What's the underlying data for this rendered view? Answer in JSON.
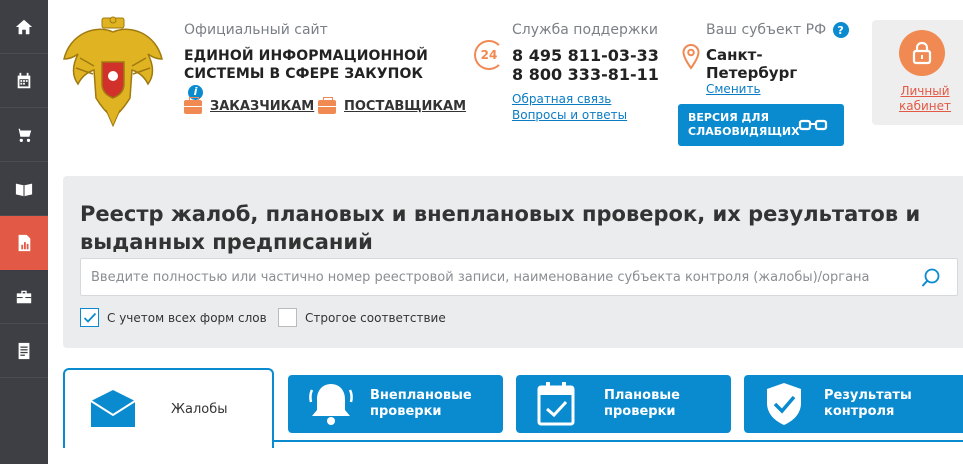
{
  "sidebar": {
    "items": [
      {
        "icon": "home-icon",
        "active": false
      },
      {
        "icon": "calendar-icon",
        "active": false
      },
      {
        "icon": "cart-icon",
        "active": false
      },
      {
        "icon": "book-icon",
        "active": false
      },
      {
        "icon": "report-chart-icon",
        "active": true
      },
      {
        "icon": "briefcase-icon",
        "active": false
      },
      {
        "icon": "document-list-icon",
        "active": false
      }
    ]
  },
  "header": {
    "site_label": "Официальный сайт",
    "site_name": "ЕДИНОЙ ИНФОРМАЦИОННОЙ СИСТЕМЫ В СФЕРЕ ЗАКУПОК",
    "info_glyph": "i",
    "customers_link": "ЗАКАЗЧИКАМ",
    "suppliers_link": "ПОСТАВЩИКАМ"
  },
  "support": {
    "label": "Служба поддержки",
    "badge": "24",
    "phone1": "8 495 811-03-33",
    "phone2": "8 800 333-81-11",
    "feedback": "Обратная связь",
    "faq": "Вопросы и ответы"
  },
  "region": {
    "label": "Ваш субъект РФ",
    "help_glyph": "?",
    "name": "Санкт-Петербург",
    "change": "Сменить"
  },
  "accessibility": {
    "button_label": "ВЕРСИЯ ДЛЯ СЛАБОВИДЯЩИХ"
  },
  "cabinet": {
    "label": "Личный кабинет"
  },
  "search": {
    "title": "Реестр жалоб, плановых и внеплановых проверок, их результатов и выданных предписаний",
    "placeholder": "Введите полностью или частично номер реестровой записи, наименование субъекта контроля (жалобы)/органа",
    "option_all_forms": "С учетом всех форм слов",
    "option_all_forms_checked": true,
    "option_strict": "Строгое соответствие",
    "option_strict_checked": false
  },
  "tabs": [
    {
      "label": "Жалобы",
      "active": true,
      "icon": "envelope-icon"
    },
    {
      "label": "Внеплановые проверки",
      "active": false,
      "icon": "bell-icon"
    },
    {
      "label": "Плановые проверки",
      "active": false,
      "icon": "calendar-check-icon"
    },
    {
      "label": "Результаты контроля",
      "active": false,
      "icon": "shield-check-icon"
    }
  ],
  "colors": {
    "accent_blue": "#0a8bcf",
    "accent_orange": "#f08a52",
    "sidebar_bg": "#3d3f44",
    "sidebar_active": "#e25a45"
  }
}
